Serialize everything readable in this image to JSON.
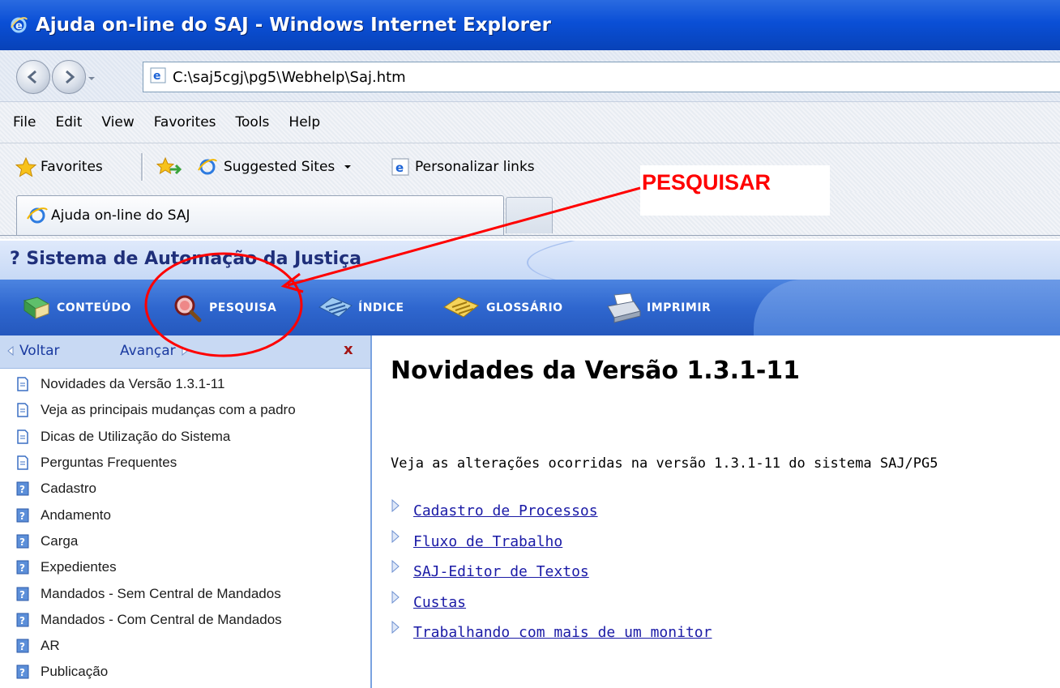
{
  "window": {
    "title": "Ajuda on-line do SAJ - Windows Internet Explorer",
    "icon": "ie-icon"
  },
  "addressbar": {
    "url": "C:\\saj5cgj\\pg5\\Webhelp\\Saj.htm"
  },
  "menubar": {
    "items": [
      "File",
      "Edit",
      "View",
      "Favorites",
      "Tools",
      "Help"
    ]
  },
  "favbar": {
    "favorites_label": "Favorites",
    "suggested_sites_label": "Suggested Sites",
    "personalizar_label": "Personalizar links"
  },
  "tabs": {
    "active_label": "Ajuda on-line do SAJ"
  },
  "annotation": {
    "label": "PESQUISAR",
    "color": "#ff0000"
  },
  "help": {
    "header_title": "? Sistema de Automação da Justiça",
    "toolbar": {
      "conteudo": "CONTEÚDO",
      "pesquisa": "PESQUISA",
      "indice": "ÍNDICE",
      "glossario": "GLOSSÁRIO",
      "imprimir": "IMPRIMIR"
    },
    "nav": {
      "back_label": "Voltar",
      "forward_label": "Avançar",
      "close_label": "x"
    },
    "toc": [
      {
        "label": "Novidades da Versão 1.3.1-11",
        "icon": "page-icon"
      },
      {
        "label": "Veja as principais mudanças com a padro",
        "icon": "page-icon"
      },
      {
        "label": "Dicas de Utilização do Sistema",
        "icon": "page-icon"
      },
      {
        "label": "Perguntas Frequentes",
        "icon": "page-icon"
      },
      {
        "label": "Cadastro",
        "icon": "help-page-icon"
      },
      {
        "label": "Andamento",
        "icon": "help-page-icon"
      },
      {
        "label": "Carga",
        "icon": "help-page-icon"
      },
      {
        "label": "Expedientes",
        "icon": "help-page-icon"
      },
      {
        "label": "Mandados - Sem Central de Mandados",
        "icon": "help-page-icon"
      },
      {
        "label": "Mandados - Com Central de Mandados",
        "icon": "help-page-icon"
      },
      {
        "label": "AR",
        "icon": "help-page-icon"
      },
      {
        "label": "Publicação",
        "icon": "help-page-icon"
      }
    ]
  },
  "content": {
    "heading": "Novidades da Versão 1.3.1-11",
    "intro": "Veja as alterações ocorridas na versão 1.3.1-11 do sistema SAJ/PG5",
    "links": [
      "Cadastro de Processos",
      "Fluxo de Trabalho",
      "SAJ-Editor de Textos",
      "Custas",
      "Trabalhando com mais de um monitor"
    ]
  },
  "colors": {
    "titlebar": "#0a4fd6",
    "help_toolbar": "#2f67cf",
    "link": "#1a1aa6",
    "annotation": "#ff0000"
  }
}
